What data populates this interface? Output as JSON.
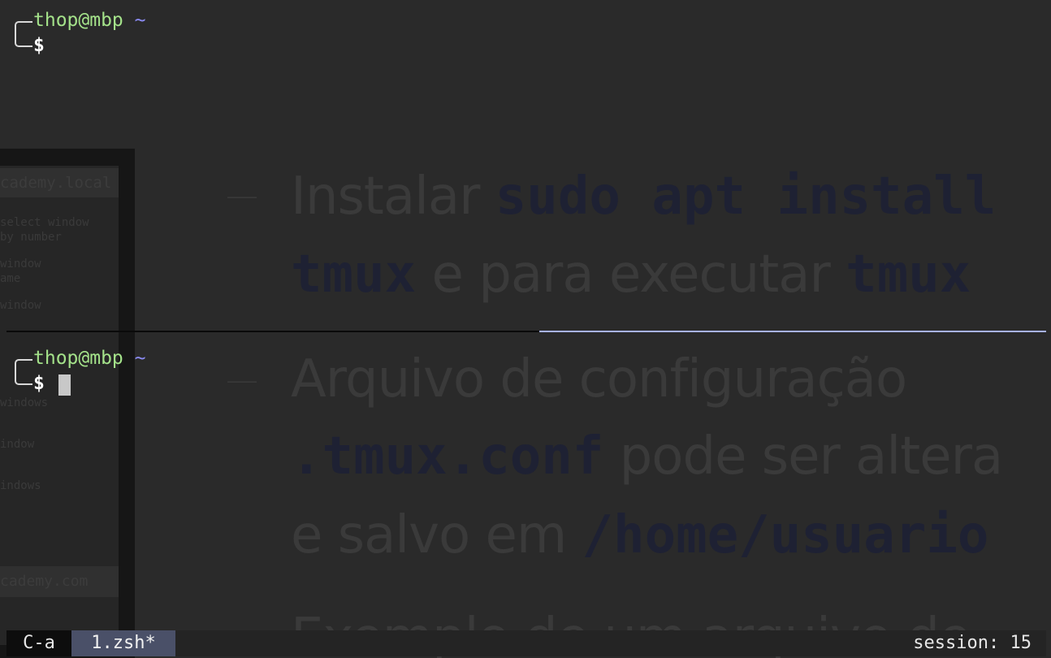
{
  "top_pane": {
    "user_host": "thop@mbp",
    "dir": "~",
    "prompt_symbol": "$"
  },
  "bottom_pane": {
    "user_host": "thop@mbp",
    "dir": "~",
    "prompt_symbol": "$"
  },
  "status_bar": {
    "prefix_key": "C-a",
    "window_tab": "1.zsh*",
    "session": "session: 15"
  },
  "colors": {
    "user_host": "#a4e28a",
    "dir": "#8c8cf5",
    "active_border": "#a7b2f0",
    "window_tab_bg": "#4a5068"
  },
  "background_slide": {
    "card_header": "cademy.local",
    "card_footer": "cademy.com",
    "card_lines": [
      "select window",
      "by number",
      "window",
      "ame",
      "window",
      "windows",
      "indow",
      "indows"
    ],
    "bullet": "—",
    "line1_text": "Instalar ",
    "line1_code": "sudo apt install",
    "line2_code": "tmux",
    "line2_text": " e para executar ",
    "line2_code2": "tmux",
    "line3_text": "Arquivo de configuração",
    "line4_code": ".tmux.conf",
    "line4_text": " pode ser altera",
    "line5_text": "e salvo em ",
    "line5_code": "/home/usuario",
    "line6_text": "Exemplo de um arquivo de"
  }
}
